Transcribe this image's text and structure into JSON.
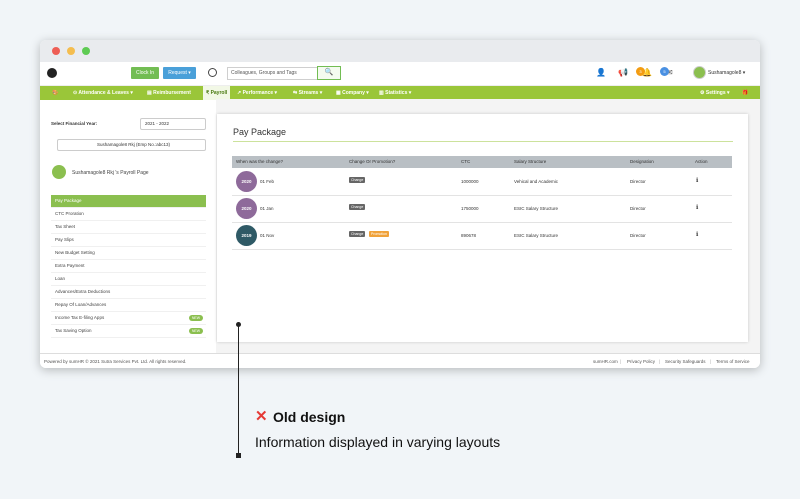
{
  "topbar": {
    "clock_in": "Clock In",
    "request": "Request ▾",
    "search_placeholder": "Colleagues, Groups and Tags",
    "user": "Sushamagole8 ▾",
    "badges": [
      "3",
      "5"
    ]
  },
  "nav": {
    "items": [
      "⊙ Attendance & Leaves ▾",
      "▤ Reimbursement",
      "₹ Payroll",
      "↗ Performance ▾",
      "⇆ Streams ▾",
      "▦ Company ▾",
      "▥ Statistics ▾"
    ],
    "settings": "⚙ Settings ▾"
  },
  "sidebar": {
    "fy_label": "Select Financial Year:",
    "fy_value": "2021 - 2022",
    "employee_value": "Sushamagole8 Rkj (Emp No.:abc13)",
    "payroll_page": "Sushamagole8 Rkj 's Payroll Page",
    "menu": [
      "Pay Package",
      "CTC Proration",
      "Tax Sheet",
      "Pay Slips",
      "New Budget Setting",
      "Extra Payment",
      "Loan",
      "Advances/Extra Deductions",
      "Repay Of Loan/Advances",
      "Income Tax E-filing Apps",
      "Tax Saving Option"
    ],
    "new_label": "NEW"
  },
  "main": {
    "title": "Pay Package",
    "headers": [
      "When was the change?",
      "Change Or Promotion?",
      "CTC",
      "Salary Structure",
      "Designation",
      "Action"
    ],
    "rows": [
      {
        "year": "2020",
        "date": "01 Feb",
        "tags": [
          "Change"
        ],
        "ctc": "1000000",
        "structure": "Vehical and Academic",
        "designation": "Director",
        "action": "ℹ",
        "color": "#8e6a9a"
      },
      {
        "year": "2020",
        "date": "01 Jan",
        "tags": [
          "Change"
        ],
        "ctc": "1750000",
        "structure": "ESIC Salary Structure",
        "designation": "Director",
        "action": "ℹ",
        "color": "#8e6a9a"
      },
      {
        "year": "2019",
        "date": "01 Nov",
        "tags": [
          "Change",
          "Promotion"
        ],
        "ctc": "890678",
        "structure": "ESIC Salary Structure",
        "designation": "Director",
        "action": "ℹ",
        "color": "#2f5a66"
      }
    ]
  },
  "footer": {
    "left": "Powered by sumHR © 2021 Sutra Services Pvt. Ltd. All rights reserved.",
    "links": [
      "sumHR.com",
      "Privacy Policy",
      "Security Safeguards",
      "Terms of Service"
    ]
  },
  "annotation": {
    "title": "Old design",
    "subtitle": "Information displayed in varying layouts"
  }
}
